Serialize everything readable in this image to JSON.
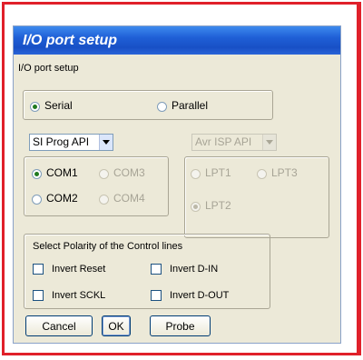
{
  "window": {
    "title": "I/O port setup"
  },
  "main_group": {
    "label": "I/O port setup"
  },
  "port_type": {
    "serial_label": "Serial",
    "parallel_label": "Parallel",
    "serial_selected": true
  },
  "serial": {
    "api_value": "SI Prog API",
    "ports": [
      {
        "label": "COM1",
        "checked": true,
        "enabled": true
      },
      {
        "label": "COM3",
        "checked": false,
        "enabled": false
      },
      {
        "label": "COM2",
        "checked": false,
        "enabled": true
      },
      {
        "label": "COM4",
        "checked": false,
        "enabled": false
      }
    ]
  },
  "parallel": {
    "api_value": "Avr ISP API",
    "ports": [
      {
        "label": "LPT1",
        "checked": false,
        "enabled": false
      },
      {
        "label": "LPT3",
        "checked": false,
        "enabled": false
      },
      {
        "label": "LPT2",
        "checked": true,
        "enabled": false
      }
    ]
  },
  "polarity": {
    "label": "Select Polarity of the Control lines",
    "options": [
      {
        "label": "Invert Reset",
        "checked": false
      },
      {
        "label": "Invert D-IN",
        "checked": false
      },
      {
        "label": "Invert SCKL",
        "checked": false
      },
      {
        "label": "Invert D-OUT",
        "checked": false
      }
    ]
  },
  "buttons": {
    "cancel": "Cancel",
    "ok": "OK",
    "probe": "Probe"
  }
}
